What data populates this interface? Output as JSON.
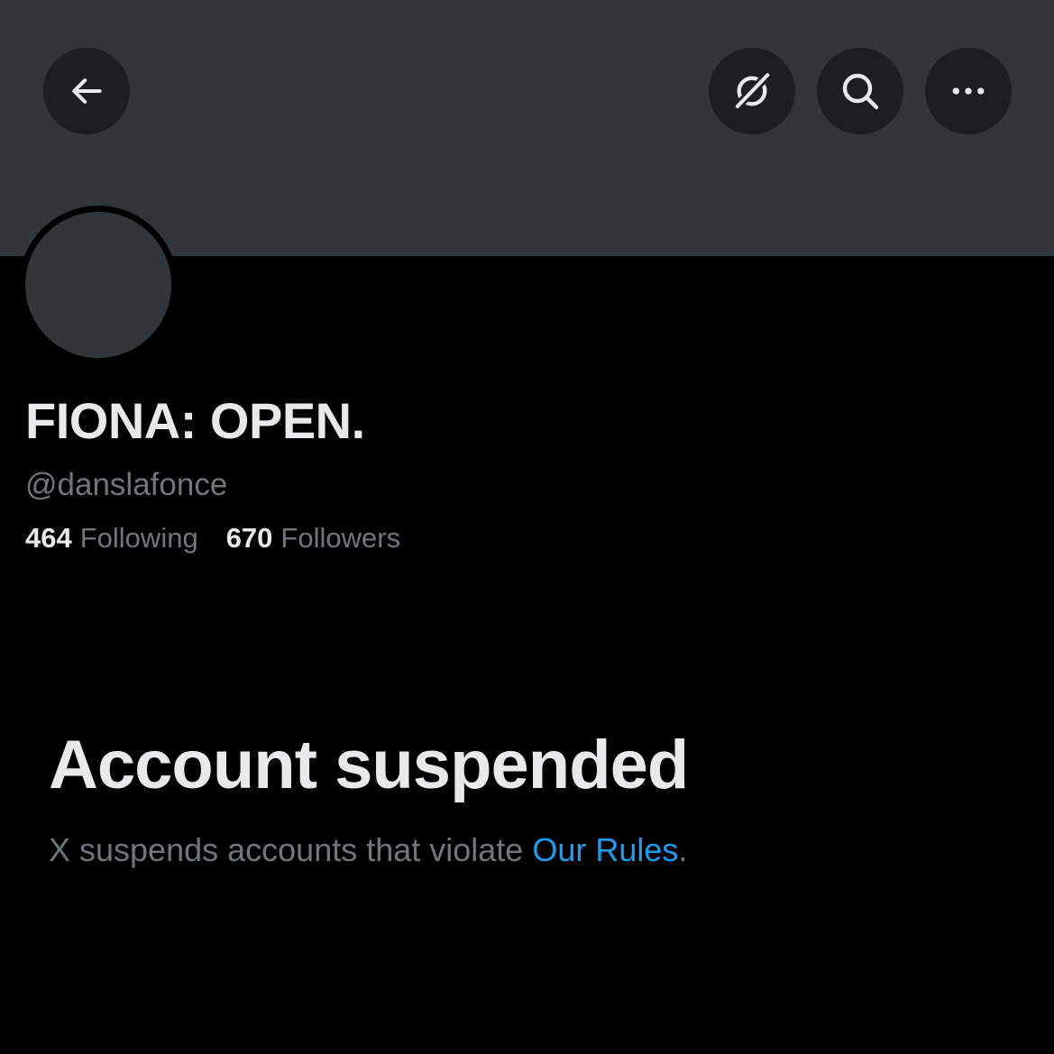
{
  "header": {
    "buttons": [
      {
        "name": "back",
        "icon": "arrow-left-icon"
      },
      {
        "name": "grok",
        "icon": "grok-icon"
      },
      {
        "name": "search",
        "icon": "search-icon"
      },
      {
        "name": "more",
        "icon": "more-horizontal-icon"
      }
    ]
  },
  "profile": {
    "display_name": "FIONA: OPEN.",
    "handle": "@danslafonce",
    "following_count": "464",
    "following_label": "Following",
    "followers_count": "670",
    "followers_label": "Followers"
  },
  "suspension": {
    "title": "Account suspended",
    "message": "X suspends accounts that violate ",
    "link_text": "Our Rules",
    "message_end": "."
  },
  "colors": {
    "background": "#000000",
    "banner": "#333639",
    "button_bg": "#1c1e20",
    "primary_text": "#e7e9ea",
    "secondary_text": "#71767b",
    "link": "#1d9bf0"
  }
}
